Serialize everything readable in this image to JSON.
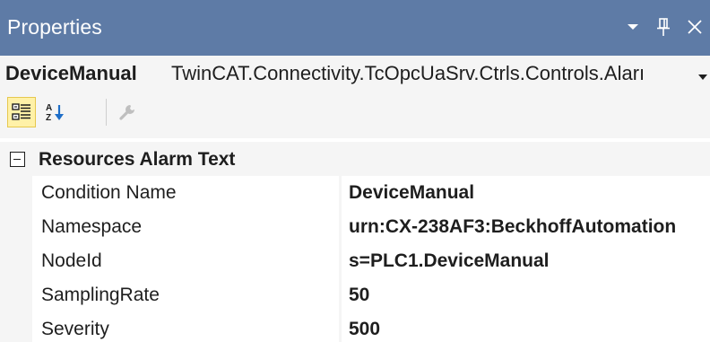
{
  "window": {
    "title": "Properties",
    "buttons": {
      "dropdown": "chevron-down-icon",
      "pin": "pin-icon",
      "close": "close-icon"
    }
  },
  "colors": {
    "titlebar": "#5e7ba6",
    "panel": "#f5f5f5",
    "cell": "#ffffff",
    "active_toolbar_button": "#fff1a8"
  },
  "selector": {
    "object_name": "DeviceManual",
    "object_type": "TwinCAT.Connectivity.TcOpcUaSrv.Ctrls.Controls.Aları",
    "icon": "chevron-down-icon"
  },
  "toolbar": {
    "categorized_icon": "categorized-icon",
    "alphabetical_icon": "sort-alphabetical-icon",
    "property_pages_icon": "wrench-icon"
  },
  "grid": {
    "category": {
      "label": "Resources Alarm Text",
      "expanded": true
    },
    "properties": [
      {
        "name": "Condition Name",
        "value": "DeviceManual"
      },
      {
        "name": "Namespace",
        "value": "urn:CX-238AF3:BeckhoffAutomation"
      },
      {
        "name": "NodeId",
        "value": "s=PLC1.DeviceManual"
      },
      {
        "name": "SamplingRate",
        "value": "50"
      },
      {
        "name": "Severity",
        "value": "500"
      }
    ]
  }
}
